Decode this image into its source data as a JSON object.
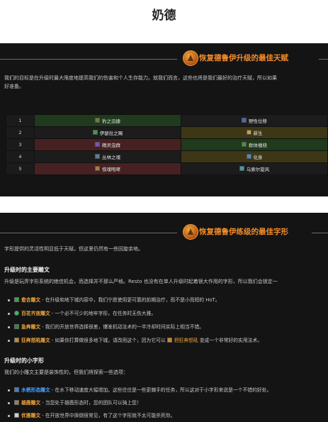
{
  "page": {
    "title": "奶德"
  },
  "talents_section": {
    "title": "恢复德鲁伊升级的最佳天赋",
    "intro": "我们的目标是在升级时最大限度地提高我们的伤害和个人生存能力。就我们而言，这些也将是我们最好的治疗天赋，所以如果",
    "intro2": "好准备。",
    "rows": [
      {
        "num": "1",
        "left": "豹之迅捷",
        "right": "野性位移"
      },
      {
        "num": "2",
        "left": "伊瑟拉之赐",
        "right": "新生"
      },
      {
        "num": "3",
        "left": "精灵虫群",
        "right": "群体缠绕"
      },
      {
        "num": "4",
        "left": "丛林之魂",
        "right": "化身"
      },
      {
        "num": "5",
        "left": "惊魂咆哮",
        "right": "乌索尔旋风"
      }
    ],
    "colors": {
      "green": "#1f3a1c",
      "gold": "#3d3716",
      "red": "#472121"
    }
  },
  "glyphs_section": {
    "title": "恢复德鲁伊练级的最佳字形",
    "intro": "字形提供的灵活性明显低于天赋，但这里仍然有一些回旋余地。",
    "major": {
      "heading": "升级时的主要雕文",
      "intro": "升级是玩弄字形系统的绝佳机会，而选择并不那么严格。Resto 也没有在单人升级时起着很大作用的字形，所以我们会锁定一",
      "items": [
        {
          "name": "愈合雕文",
          "desc": " - 在升级和地下城内容中，我们宁愿使用更可靠的前期治疗，而不是小而短的 HoT。",
          "icon": "green-leaf-icon"
        },
        {
          "name": "百花齐放雕文",
          "desc": " - 一个必不可少的地牢字形，在任务时无伤大雅。",
          "icon": "flower-icon"
        },
        {
          "name": "急奔雕文",
          "desc": " - 我们的开放世界选择很差，爆发机动法术的一半冷却时间实际上相当不错。",
          "icon": "dash-icon"
        },
        {
          "name": "狂奔怒吼雕文",
          "desc": " - 如果你打算做很多地下城，请改用这个，因为它可以",
          "desc2": "把狂奔怒吼",
          "desc3": "变成一个非常好的实用法术。",
          "icon": "roar-icon"
        }
      ]
    },
    "minor": {
      "heading": "升级时的小字形",
      "intro": "我们的小雕文主要是装饰性的，但我们将探索一些选项：",
      "items": [
        {
          "name": "水栖形态雕文",
          "desc": " - 在水下移动速度大幅增加。这些往往是一些更棘手的任务，所以这对于小字形来说是一个不错的好处。",
          "icon": "aquatic-form-icon"
        },
        {
          "name": "雄鹿雕文",
          "desc": " - 当您处于雄鹿形态时，您的团队可以骑上您！",
          "icon": "stag-icon"
        },
        {
          "name": "优雅雕文",
          "desc": " - 在开放世界中摔倒很常见，有了这个字形就不太可能杀死你。",
          "icon": "feather-icon"
        }
      ]
    }
  }
}
